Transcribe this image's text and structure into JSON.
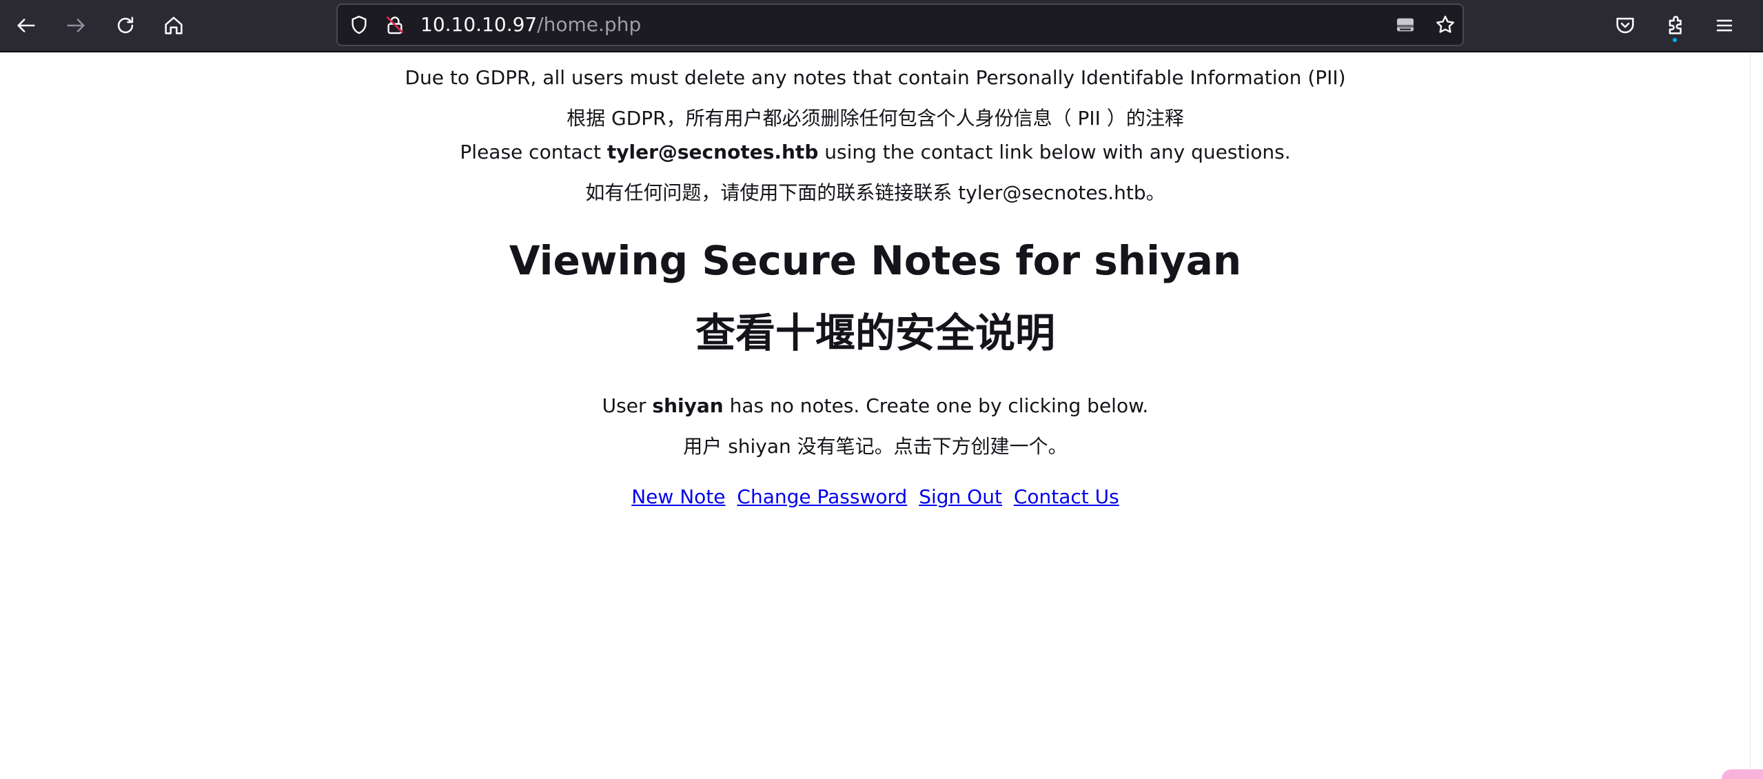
{
  "browser": {
    "url_host": "10.10.10.97",
    "url_path": "/home.php",
    "icons": {
      "back": "back-arrow-icon",
      "forward": "forward-arrow-icon",
      "reload": "reload-icon",
      "home": "home-icon",
      "tracking": "shield-icon",
      "insecure": "insecure-lock-icon",
      "reader": "reader-view-icon",
      "bookmark": "star-icon",
      "pocket": "pocket-icon",
      "extensions": "extensions-icon",
      "menu": "hamburger-menu-icon"
    }
  },
  "notice": {
    "gdpr_en": "Due to GDPR, all users must delete any notes that contain Personally Identifable Information (PII)",
    "gdpr_zh": "根据 GDPR，所有用户都必须删除任何包含个人身份信息（ PII ）的注释",
    "contact_prefix": "Please contact ",
    "contact_email": "tyler@secnotes.htb",
    "contact_suffix": " using the contact link below with any questions.",
    "contact_zh": "如有任何问题，请使用下面的联系链接联系 tyler@secnotes.htb。"
  },
  "heading": {
    "title_en": "Viewing Secure Notes for shiyan",
    "title_zh": "查看十堰的安全说明"
  },
  "notes_status": {
    "prefix": "User ",
    "username": "shiyan",
    "suffix": " has no notes. Create one by clicking below.",
    "zh": "用户 shiyan 没有笔记。点击下方创建一个。"
  },
  "links": {
    "new_note": "New Note",
    "change_password": "Change Password",
    "sign_out": "Sign Out",
    "contact_us": "Contact Us"
  },
  "colors": {
    "toolbar_bg": "#2b2a33",
    "urlbar_bg": "#1c1b22",
    "link": "#0000ee",
    "text": "#15141a"
  }
}
